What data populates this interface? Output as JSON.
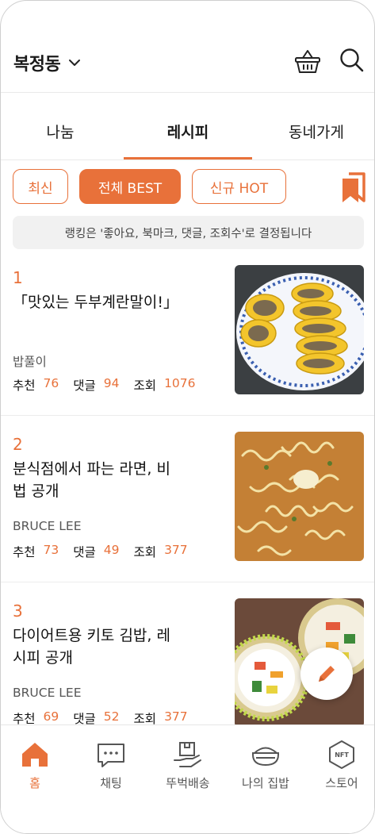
{
  "header": {
    "location": "복정동",
    "icons": [
      "chevron-down-icon",
      "basket-icon",
      "search-icon"
    ]
  },
  "tabs": [
    {
      "label": "나눔",
      "active": false
    },
    {
      "label": "레시피",
      "active": true
    },
    {
      "label": "동네가게",
      "active": false
    }
  ],
  "filters": [
    {
      "label": "최신",
      "active": false
    },
    {
      "label": "전체 BEST",
      "active": true
    },
    {
      "label": "신규 HOT",
      "active": false
    }
  ],
  "notice": "랭킹은 '좋아요, 북마크, 댓글, 조회수'로 결정됩니다",
  "stat_labels": {
    "recommend": "추천",
    "comment": "댓글",
    "view": "조회"
  },
  "recipes": [
    {
      "rank": "1",
      "title": "「맛있는 두부계란말이!」",
      "author": "밥풀이",
      "recommend": "76",
      "comment": "94",
      "view": "1076",
      "image": "tofu-egg-roll-photo"
    },
    {
      "rank": "2",
      "title": "분식점에서 파는 라면, 비법 공개",
      "author": "BRUCE LEE",
      "recommend": "73",
      "comment": "49",
      "view": "377",
      "image": "ramen-photo"
    },
    {
      "rank": "3",
      "title": "다이어트용 키토 김밥, 레시피 공개",
      "author": "BRUCE LEE",
      "recommend": "69",
      "comment": "52",
      "view": "377",
      "image": "kimbap-photo"
    }
  ],
  "bottom_nav": [
    {
      "label": "홈",
      "icon": "home-icon",
      "active": true
    },
    {
      "label": "채팅",
      "icon": "chat-icon",
      "active": false
    },
    {
      "label": "뚜벅배송",
      "icon": "delivery-box-icon",
      "active": false
    },
    {
      "label": "나의 집밥",
      "icon": "rice-bowl-icon",
      "active": false
    },
    {
      "label": "스토어",
      "icon": "nft-store-icon",
      "active": false
    }
  ],
  "nft_badge": "NFT",
  "colors": {
    "accent": "#e8713a",
    "text": "#111111",
    "muted": "#555555",
    "notice_bg": "#f1f1f1"
  }
}
